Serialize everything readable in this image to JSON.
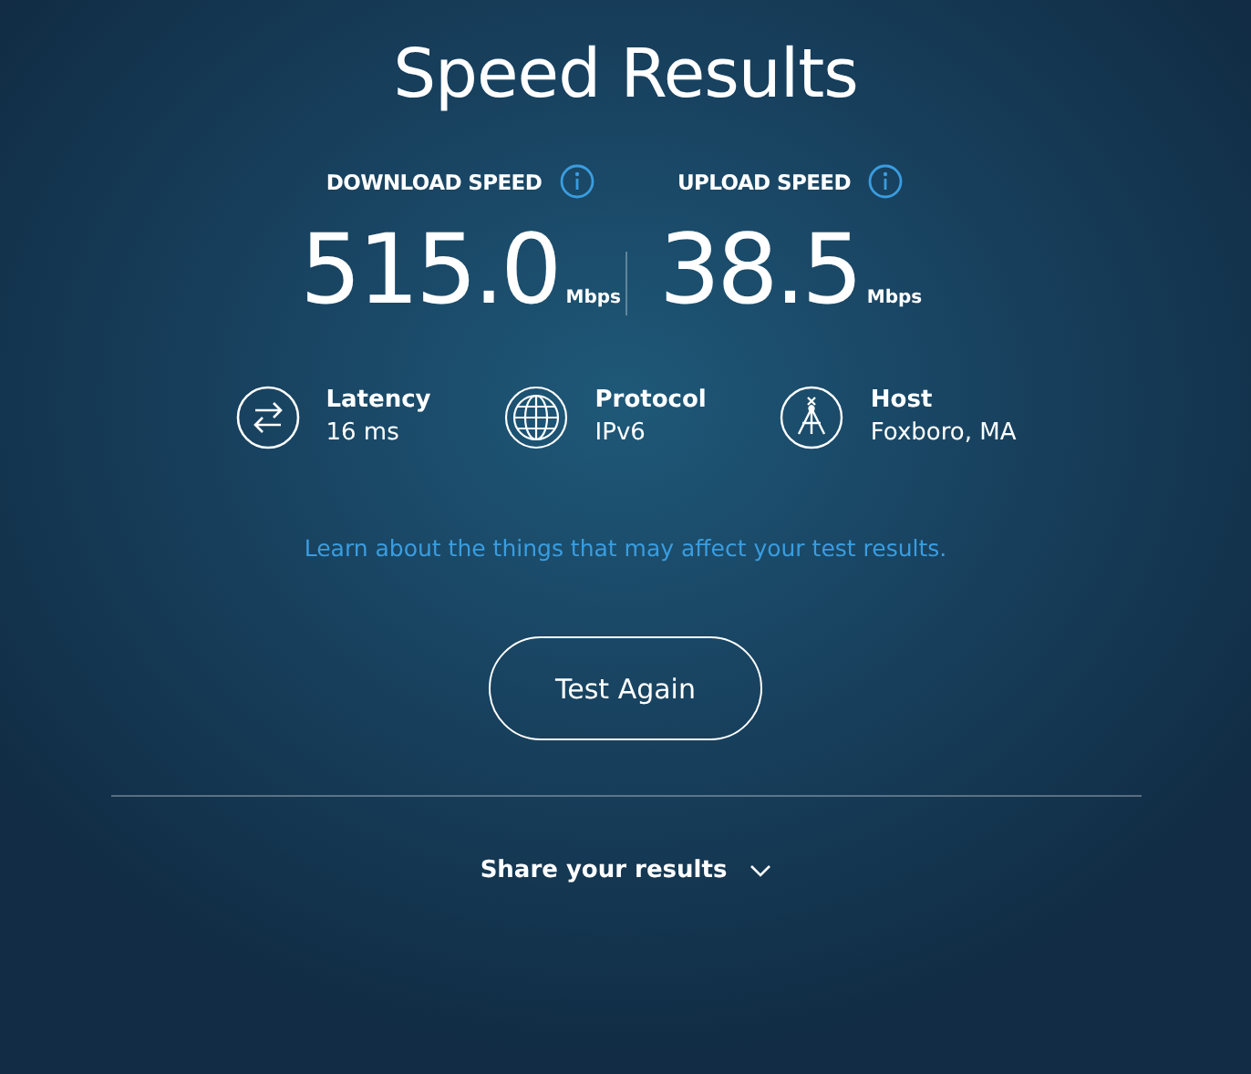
{
  "title": "Speed Results",
  "speeds": [
    {
      "label": "DOWNLOAD SPEED",
      "value": "515.0",
      "unit": "Mbps"
    },
    {
      "label": "UPLOAD SPEED",
      "value": "38.5",
      "unit": "Mbps"
    }
  ],
  "details": [
    {
      "kind": "latency",
      "label": "Latency",
      "value": "16 ms"
    },
    {
      "kind": "protocol",
      "label": "Protocol",
      "value": "IPv6"
    },
    {
      "kind": "host",
      "label": "Host",
      "value": "Foxboro, MA"
    }
  ],
  "link": "Learn about the things that may affect your test results.",
  "button": "Test Again",
  "share": "Share your results"
}
